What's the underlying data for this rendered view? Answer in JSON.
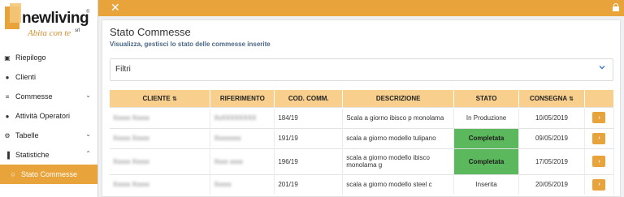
{
  "brand": {
    "name": "newliving",
    "tagline": "Abita con te",
    "suffix": "srl",
    "reg": "®",
    "color": "#e8a43a"
  },
  "sidebar": {
    "items": [
      {
        "label": "Riepilogo",
        "icon": "dashboard-icon",
        "glyph": "▣"
      },
      {
        "label": "Clienti",
        "icon": "user-icon",
        "glyph": "●"
      },
      {
        "label": "Commesse",
        "icon": "list-icon",
        "glyph": "≡",
        "chevron": "⌄"
      },
      {
        "label": "Attività Operatori",
        "icon": "users-icon",
        "glyph": "●"
      },
      {
        "label": "Tabelle",
        "icon": "gear-icon",
        "glyph": "⚙",
        "chevron": "⌄"
      },
      {
        "label": "Statistiche",
        "icon": "bar-chart-icon",
        "glyph": "▐",
        "chevron": "⌃"
      }
    ],
    "active_item": {
      "label": "Stato Commesse",
      "icon": "circle-icon",
      "glyph": "○"
    }
  },
  "topbar": {
    "close_glyph": "✕"
  },
  "main": {
    "title": "Stato Commesse",
    "subtitle": "Visualizza, gestisci lo stato delle commesse inserite",
    "filters_label": "Filtri"
  },
  "table": {
    "headers": [
      "CLIENTE",
      "RIFERIMENTO",
      "COD. COMM.",
      "DESCRIZIONE",
      "STATO",
      "CONSEGNA",
      ""
    ],
    "sort_glyph": "⇅",
    "rows": [
      {
        "cliente": "Xxxxx Xxxxx",
        "riferimento": "XxXXXXXXXX",
        "cod": "184/19",
        "descrizione": "Scala a giorno ibisco p monolama",
        "stato": "In Produzione",
        "stato_color": "#ffffff",
        "consegna": "10/05/2019",
        "action_glyph": "›"
      },
      {
        "cliente": "Xxxxx Xxxxx",
        "riferimento": "Xxxxxxxx",
        "cod": "191/19",
        "descrizione": "scala a giorno modello tulipano",
        "stato": "Completata",
        "stato_color": "#5cb85c",
        "consegna": "09/05/2019",
        "action_glyph": "›"
      },
      {
        "cliente": "Xxxxx Xxxxx",
        "riferimento": "Xxxx xxxx",
        "cod": "196/19",
        "descrizione": "scala a giorno modello ibisco monolama g",
        "stato": "Completata",
        "stato_color": "#5cb85c",
        "consegna": "17/05/2019",
        "action_glyph": "›"
      },
      {
        "cliente": "Xxxxx Xxxxx",
        "riferimento": "Xxxxx",
        "cod": "201/19",
        "descrizione": "scala a giorno modello steel c",
        "stato": "Inserita",
        "stato_color": "#ffffff",
        "consegna": "20/05/2019",
        "action_glyph": "›"
      }
    ]
  },
  "colors": {
    "accent": "#e8a43a",
    "header_bg": "#f8cf8c",
    "completata": "#5cb85c",
    "subtitle": "#4a6785"
  }
}
